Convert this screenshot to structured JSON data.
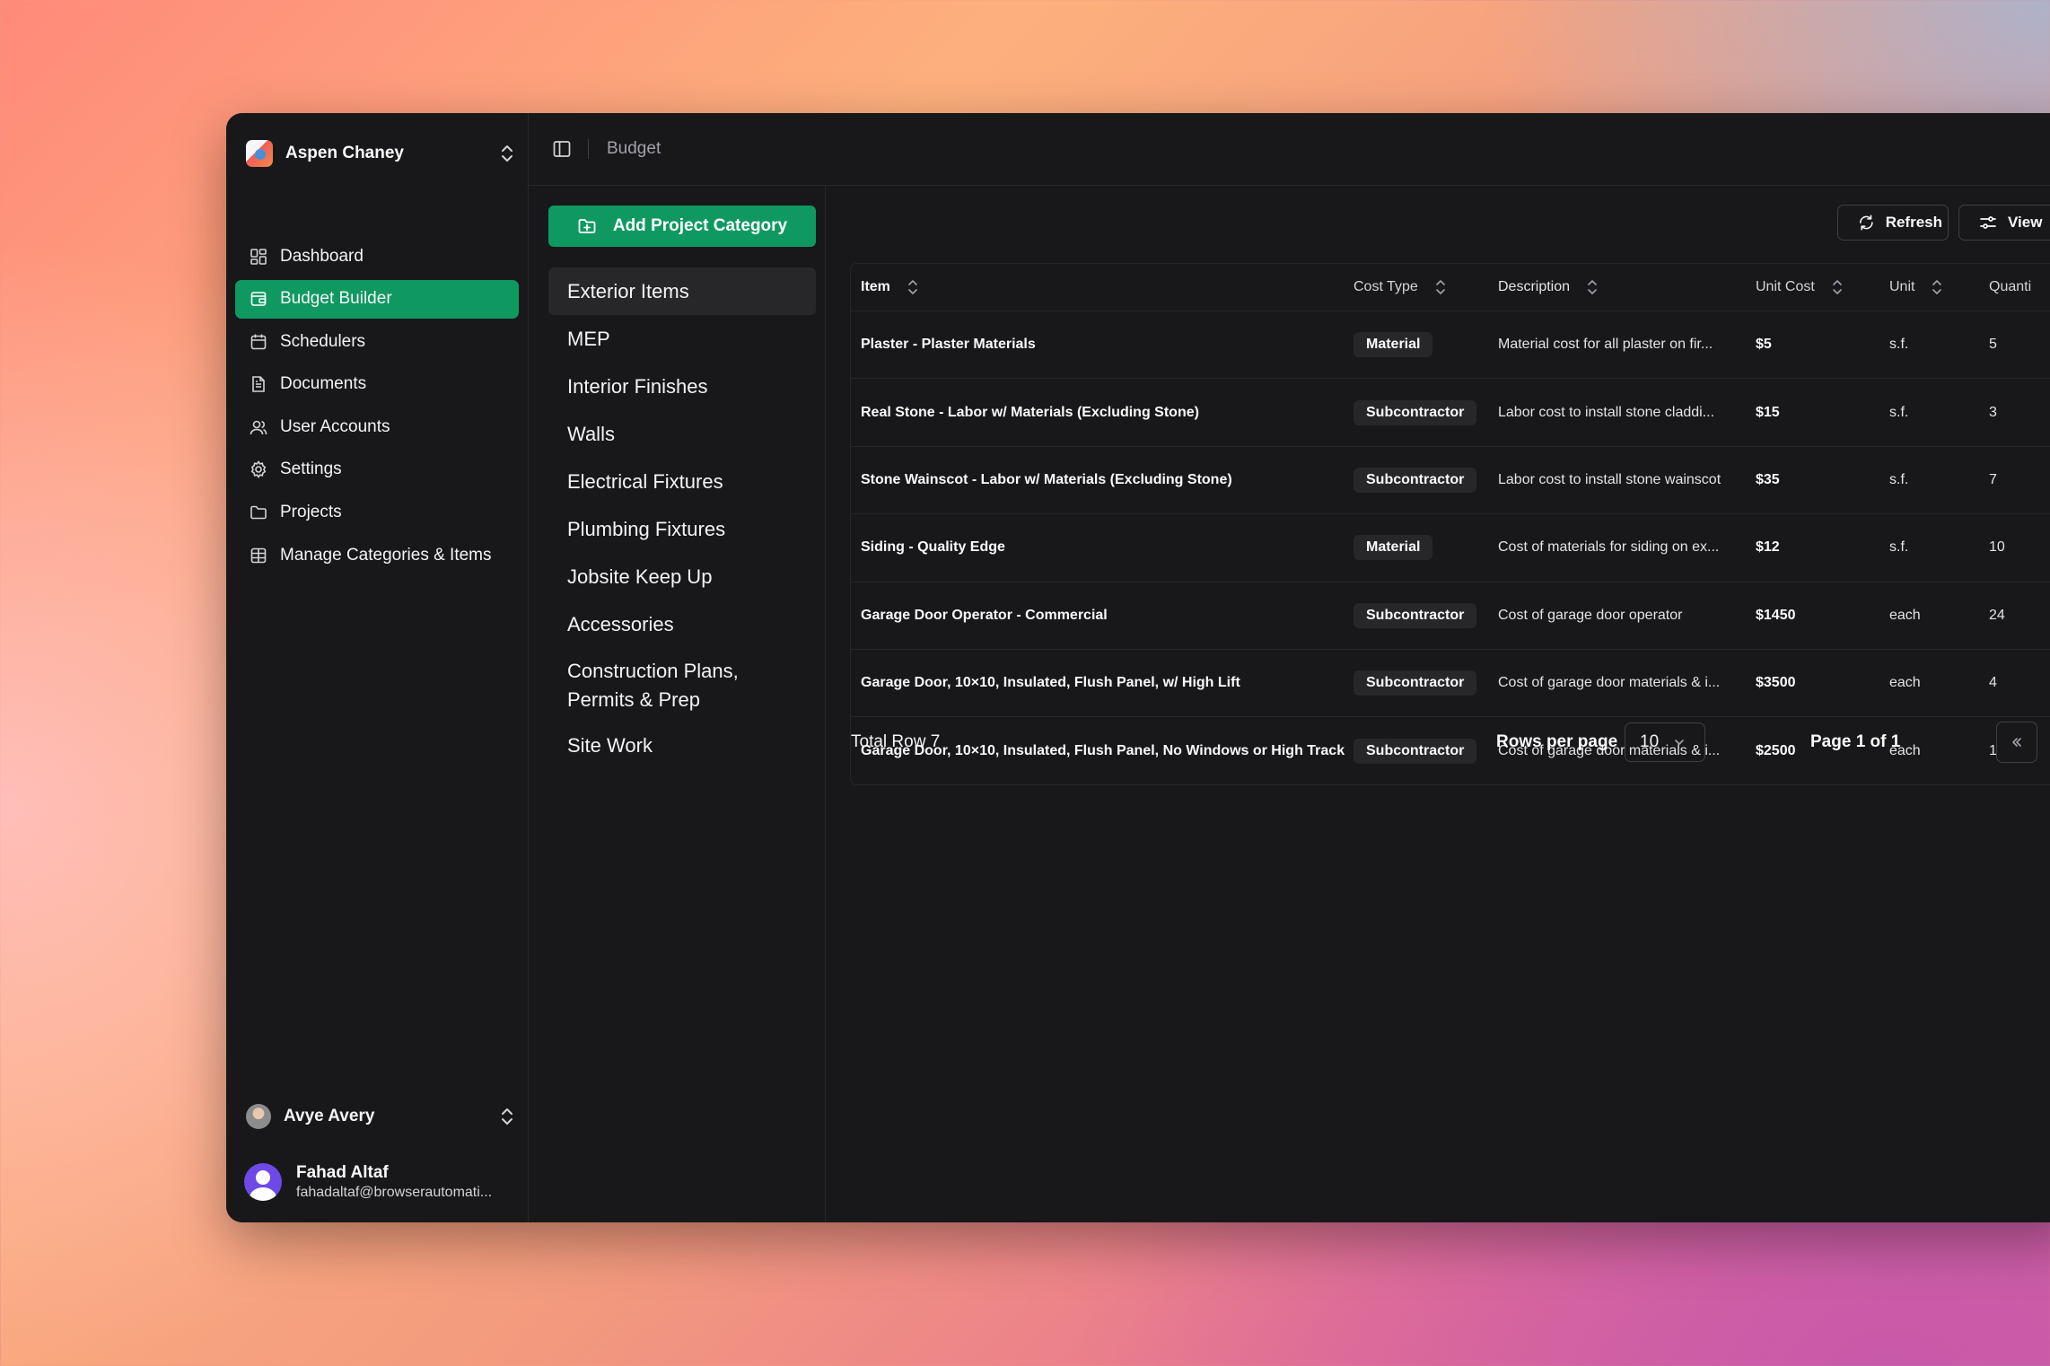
{
  "sidebar": {
    "team": "Aspen Chaney",
    "items": [
      {
        "label": "Dashboard",
        "icon": "dashboard-icon",
        "active": false
      },
      {
        "label": "Budget Builder",
        "icon": "wallet-icon",
        "active": true
      },
      {
        "label": "Schedulers",
        "icon": "calendar-icon",
        "active": false
      },
      {
        "label": "Documents",
        "icon": "document-icon",
        "active": false
      },
      {
        "label": "User Accounts",
        "icon": "users-icon",
        "active": false
      },
      {
        "label": "Settings",
        "icon": "gear-icon",
        "active": false
      },
      {
        "label": "Projects",
        "icon": "folder-icon",
        "active": false
      },
      {
        "label": "Manage Categories & Items",
        "icon": "table-icon",
        "active": false
      }
    ],
    "user_switch": "Avye Avery",
    "account": {
      "name": "Fahad Altaf",
      "email": "fahadaltaf@browserautomati..."
    }
  },
  "header": {
    "breadcrumb": "Budget"
  },
  "categories": {
    "add_label": "Add Project Category",
    "items": [
      "Exterior Items",
      "MEP",
      "Interior Finishes",
      "Walls",
      "Electrical Fixtures",
      "Plumbing Fixtures",
      "Jobsite Keep Up",
      "Accessories",
      "Construction Plans, Permits & Prep",
      "Site Work"
    ],
    "active": "Exterior Items"
  },
  "toolbar": {
    "refresh_label": "Refresh",
    "view_label": "View"
  },
  "table": {
    "columns": [
      "Item",
      "Cost Type",
      "Description",
      "Unit Cost",
      "Unit",
      "Quanti"
    ],
    "rows": [
      {
        "item": "Plaster - Plaster Materials",
        "cost_type": "Material",
        "description": "Material cost for all plaster on fir...",
        "unit_cost": "$5",
        "unit": "s.f.",
        "qty": "5"
      },
      {
        "item": "Real Stone - Labor w/ Materials (Excluding Stone)",
        "cost_type": "Subcontractor",
        "description": "Labor cost to install stone claddi...",
        "unit_cost": "$15",
        "unit": "s.f.",
        "qty": "3"
      },
      {
        "item": "Stone Wainscot - Labor w/ Materials (Excluding Stone)",
        "cost_type": "Subcontractor",
        "description": "Labor cost to install stone wainscot",
        "unit_cost": "$35",
        "unit": "s.f.",
        "qty": "7"
      },
      {
        "item": "Siding - Quality Edge",
        "cost_type": "Material",
        "description": "Cost of materials for siding on ex...",
        "unit_cost": "$12",
        "unit": "s.f.",
        "qty": "10"
      },
      {
        "item": "Garage Door Operator - Commercial",
        "cost_type": "Subcontractor",
        "description": "Cost of garage door operator",
        "unit_cost": "$1450",
        "unit": "each",
        "qty": "24"
      },
      {
        "item": "Garage Door, 10×10, Insulated, Flush Panel, w/ High Lift",
        "cost_type": "Subcontractor",
        "description": "Cost of garage door materials & i...",
        "unit_cost": "$3500",
        "unit": "each",
        "qty": "4"
      },
      {
        "item": "Garage Door, 10×10, Insulated, Flush Panel, No Windows or High Track",
        "cost_type": "Subcontractor",
        "description": "Cost of garage door materials & i...",
        "unit_cost": "$2500",
        "unit": "each",
        "qty": "1"
      }
    ]
  },
  "footer": {
    "total": "Total Row 7",
    "rows_per_page_label": "Rows per page",
    "rows_per_page_value": "10",
    "page_label": "Page 1 of 1"
  }
}
